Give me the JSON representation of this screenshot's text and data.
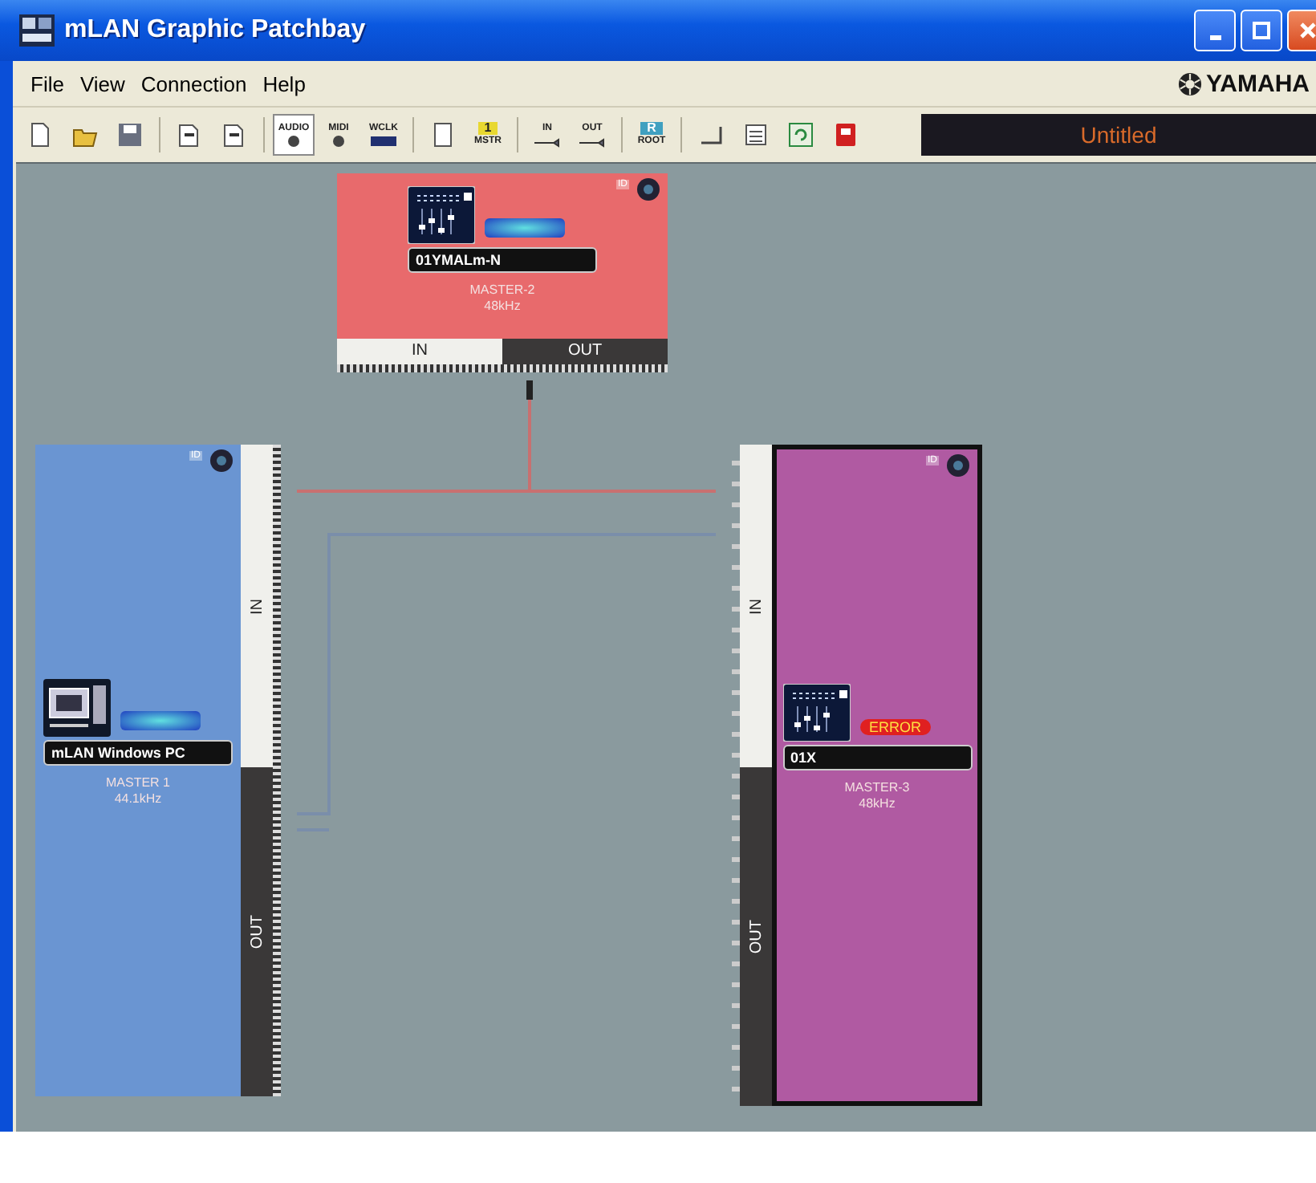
{
  "window": {
    "title": "mLAN Graphic Patchbay"
  },
  "menu": [
    {
      "label": "File"
    },
    {
      "label": "View"
    },
    {
      "label": "Connection"
    },
    {
      "label": "Help"
    }
  ],
  "brand": "YAMAHA",
  "toolbar": [
    {
      "kind": "new"
    },
    {
      "kind": "open"
    },
    {
      "kind": "save"
    },
    {
      "kind": "sep"
    },
    {
      "kind": "export"
    },
    {
      "kind": "import"
    },
    {
      "kind": "sep"
    },
    {
      "kind": "audio",
      "label": "AUDIO",
      "selected": true
    },
    {
      "kind": "midi",
      "label": "MIDI",
      "selected": false
    },
    {
      "kind": "wclk",
      "label": "WCLK",
      "selected": false
    },
    {
      "kind": "sep"
    },
    {
      "kind": "page"
    },
    {
      "kind": "master",
      "label": "1",
      "sublabel": "MSTR"
    },
    {
      "kind": "sep"
    },
    {
      "kind": "in",
      "label": "IN"
    },
    {
      "kind": "out",
      "label": "OUT"
    },
    {
      "kind": "sep"
    },
    {
      "kind": "root",
      "label": "R",
      "sublabel": "ROOT"
    },
    {
      "kind": "sep"
    },
    {
      "kind": "corner"
    },
    {
      "kind": "list"
    },
    {
      "kind": "refresh"
    },
    {
      "kind": "book"
    }
  ],
  "document_title": "Untitled",
  "devices": [
    {
      "kind": "bottom-ports",
      "name": "01YMALm-N",
      "clock": "MASTER-2",
      "rate": "48kHz",
      "id_label": "ID",
      "color": "#e86a6c",
      "error": false,
      "selected": false,
      "ports": {
        "in": "IN",
        "out": "OUT"
      }
    },
    {
      "kind": "side-ports",
      "name": "mLAN Windows PC",
      "clock": "MASTER 1",
      "rate": "44.1kHz",
      "id_label": "ID",
      "color": "#6a95d2",
      "error": false,
      "selected": false,
      "ports": {
        "in": "IN",
        "out": "OUT"
      }
    },
    {
      "kind": "side-ports",
      "name": "01X",
      "clock": "MASTER-3",
      "rate": "48kHz",
      "id_label": "ID",
      "color": "#b05aa2",
      "error": true,
      "status_label": "ERROR",
      "selected": true,
      "ports": {
        "in": "IN",
        "out": "OUT"
      }
    }
  ]
}
